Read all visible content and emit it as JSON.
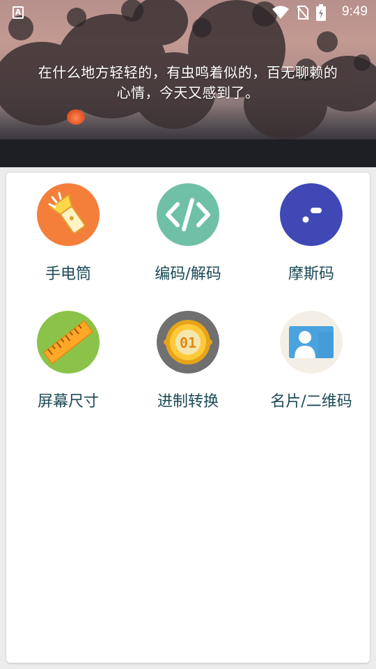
{
  "status_bar": {
    "app_badge": "A",
    "time": "9:49",
    "icons": [
      "wifi-icon",
      "no-sim-icon",
      "battery-charging-icon"
    ]
  },
  "header": {
    "quote_line1": "在什么地方轻轻的，有虫鸣着似的，百无聊赖的",
    "quote_line2": "心情，今天又感到了。"
  },
  "tools": [
    {
      "label": "手电筒",
      "icon": "flashlight-icon",
      "color": "#f47f3a"
    },
    {
      "label": "编码/解码",
      "icon": "code-icon",
      "color": "#6fc0a7"
    },
    {
      "label": "摩斯码",
      "icon": "morse-icon",
      "color": "#3f48b5"
    },
    {
      "label": "屏幕尺寸",
      "icon": "ruler-icon",
      "color": "#8bc34a"
    },
    {
      "label": "进制转换",
      "icon": "binary-coin-icon",
      "color": "#707070"
    },
    {
      "label": "名片/二维码",
      "icon": "business-card-icon",
      "color": "#f4efe6"
    }
  ]
}
